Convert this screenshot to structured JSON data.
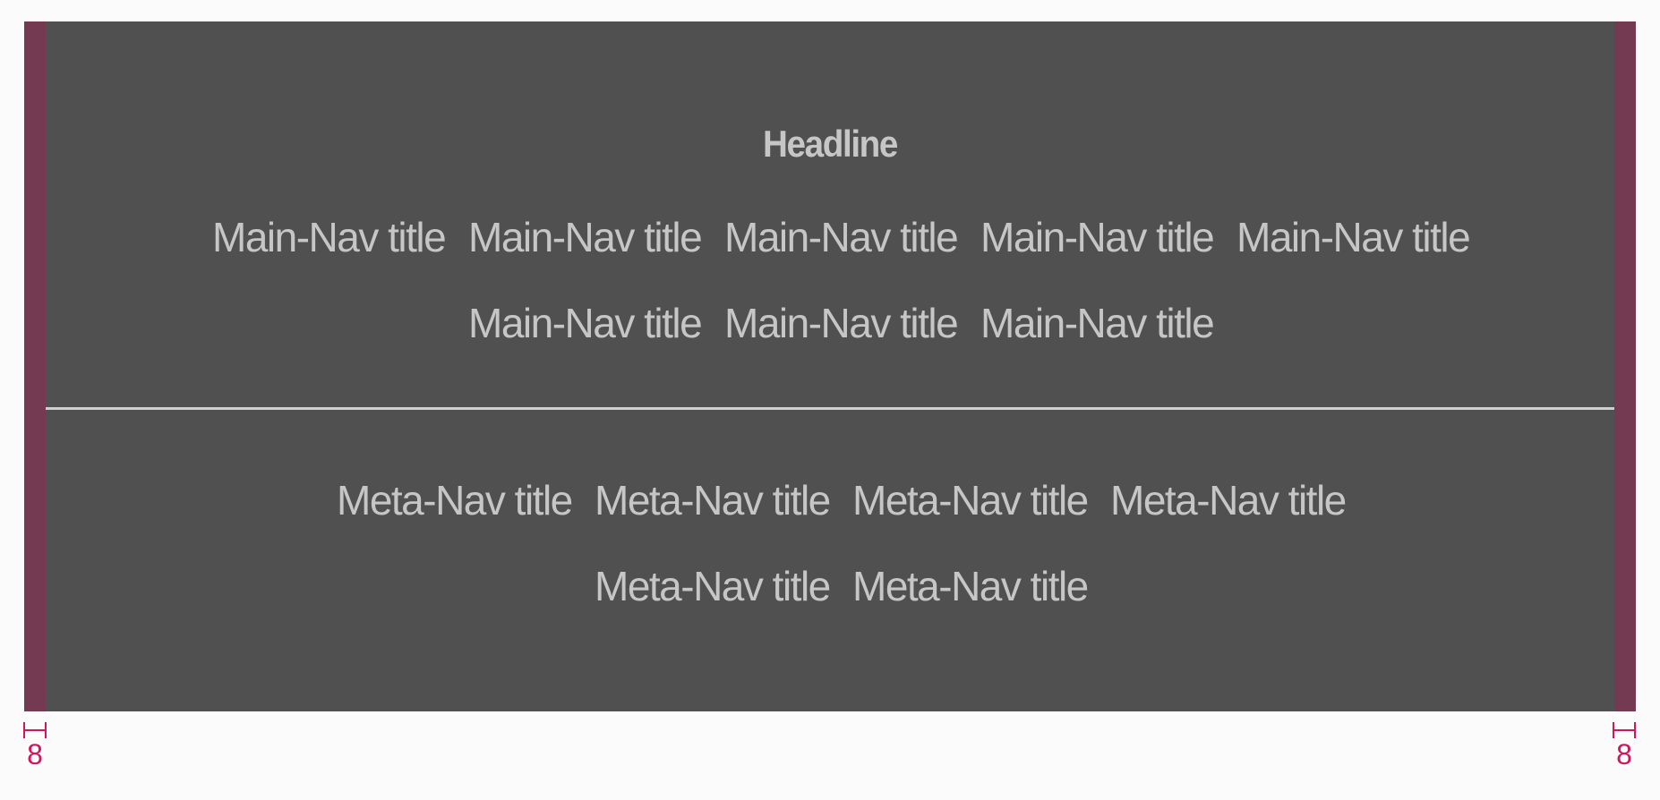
{
  "headline": "Headline",
  "main_nav": {
    "row1": [
      "Main-Nav title",
      "Main-Nav title",
      "Main-Nav title",
      "Main-Nav title",
      "Main-Nav title"
    ],
    "row2": [
      "Main-Nav title",
      "Main-Nav title",
      "Main-Nav title"
    ]
  },
  "meta_nav": {
    "row1": [
      "Meta-Nav title",
      "Meta-Nav title",
      "Meta-Nav title",
      "Meta-Nav title"
    ],
    "row2": [
      "Meta-Nav title",
      "Meta-Nav title"
    ]
  },
  "margin_markers": {
    "left": "8",
    "right": "8"
  },
  "colors": {
    "panel": "#505050",
    "margin_strip": "#743a51",
    "text": "#c6c6c6",
    "divider": "#cfcfcf",
    "marker": "#d0175d"
  }
}
